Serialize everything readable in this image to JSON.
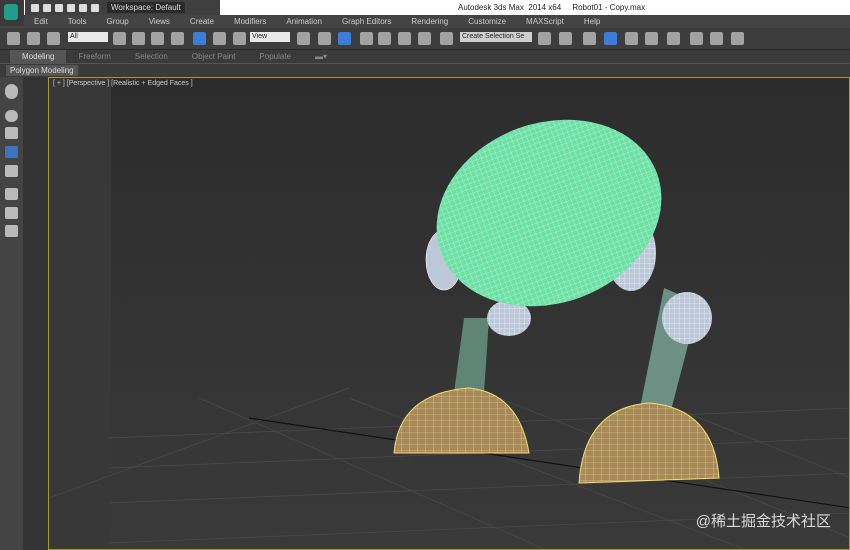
{
  "title": {
    "app": "Autodesk 3ds Max  2014 x64",
    "file": "Robot01 - Copy.max"
  },
  "quick_access": {
    "workspace": "Workspace: Default"
  },
  "menu": [
    "Edit",
    "Tools",
    "Group",
    "Views",
    "Create",
    "Modifiers",
    "Animation",
    "Graph Editors",
    "Rendering",
    "Customize",
    "MAXScript",
    "Help"
  ],
  "toolbar": {
    "filter": "All",
    "ref_coord": "View",
    "selection_set": "Create Selection Se"
  },
  "ribbon": {
    "tabs": [
      "Modeling",
      "Freeform",
      "Selection",
      "Object Paint",
      "Populate"
    ],
    "active": "Modeling",
    "panel": "Polygon Modeling"
  },
  "viewport": {
    "label": "[ + ] [Perspective ] [Realistic + Edged Faces ]"
  },
  "watermark": "@稀土掘金技术社区"
}
